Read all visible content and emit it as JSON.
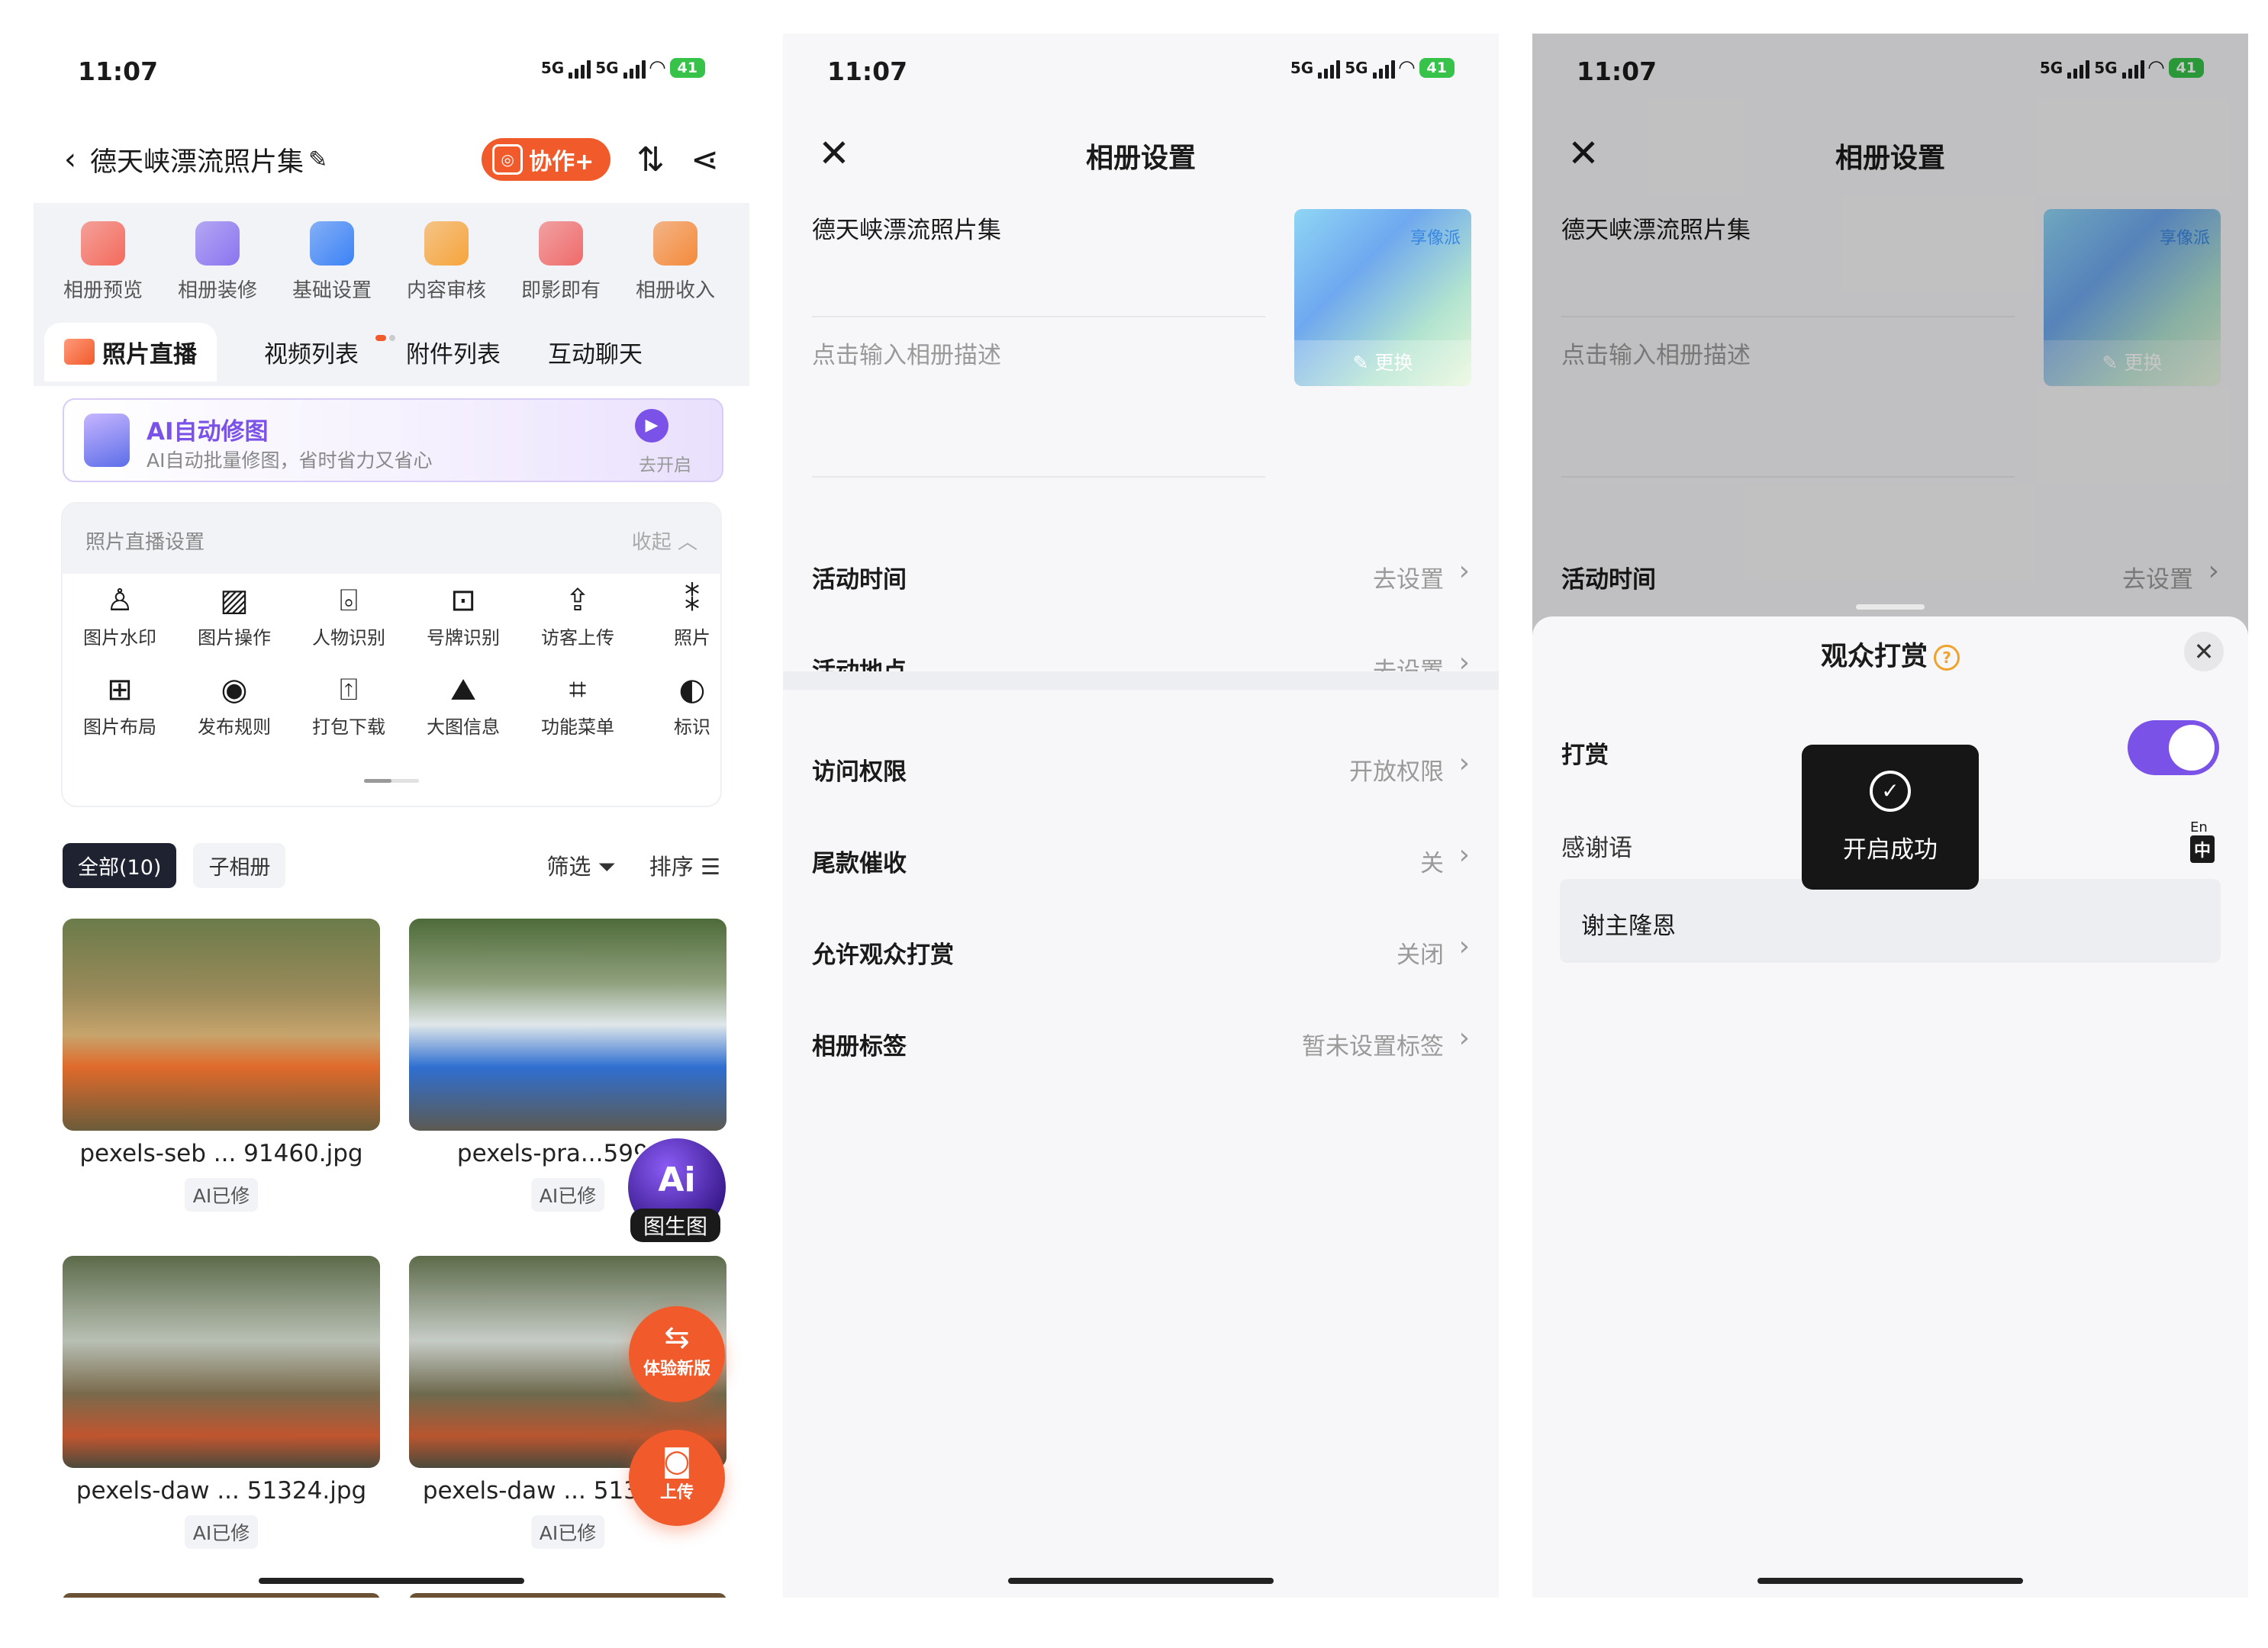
{
  "status_bar": {
    "time": "11:07",
    "net1": "5G",
    "net2": "5G",
    "battery": "41"
  },
  "screen1": {
    "header": {
      "back_icon": "chevron-left-icon",
      "title": "德天峡漂流照片集",
      "collab_label": "协作+",
      "sort_icon": "sort-icon",
      "share_icon": "share-icon"
    },
    "tools": [
      {
        "label": "相册预览",
        "color": "#f46a5c"
      },
      {
        "label": "相册装修",
        "color": "#8b74f0"
      },
      {
        "label": "基础设置",
        "color": "#3b82f6"
      },
      {
        "label": "内容审核",
        "color": "#f6a43b"
      },
      {
        "label": "即影即有",
        "color": "#f06a6a"
      },
      {
        "label": "相册收入",
        "color": "#f48a3b"
      }
    ],
    "tabs": [
      "照片直播",
      "视频列表",
      "附件列表",
      "互动聊天"
    ],
    "ai_banner": {
      "title": "AI自动修图",
      "subtitle": "AI自动批量修图，省时省力又省心",
      "action": "去开启"
    },
    "settings": {
      "title": "照片直播设置",
      "collapse": "收起",
      "items": [
        "图片水印",
        "图片操作",
        "人物识别",
        "号牌识别",
        "访客上传",
        "照片",
        "图片布局",
        "发布规则",
        "打包下载",
        "大图信息",
        "功能菜单",
        "标识"
      ],
      "icons": [
        "♙",
        "▨",
        "⌻",
        "⊡",
        "⇪",
        "⁑",
        "⊞",
        "◉",
        "⍐",
        "⛰",
        "⌗",
        "◐"
      ]
    },
    "filters": {
      "all": "全部(10)",
      "sub": "子相册",
      "filter": "筛选",
      "sort": "排序"
    },
    "photos": [
      {
        "name": "pexels-seb ... 91460.jpg",
        "tag": "AI已修"
      },
      {
        "name": "pexels-pra...59908",
        "tag": "AI已修"
      },
      {
        "name": "pexels-daw ... 51324.jpg",
        "tag": "AI已修"
      },
      {
        "name": "pexels-daw ... 51325.jpg",
        "tag": "AI已修"
      }
    ],
    "fab_ai": {
      "label": "图生图"
    },
    "fab_new": {
      "label": "体验新版"
    },
    "fab_upload": {
      "label": "上传"
    }
  },
  "screen2": {
    "title": "相册设置",
    "album_name": "德天峡漂流照片集",
    "desc_placeholder": "点击输入相册描述",
    "cover_brand": "享像派",
    "cover_change": "更换",
    "rows": [
      {
        "label": "活动时间",
        "value": "去设置"
      },
      {
        "label": "活动地点",
        "value": "去设置"
      },
      {
        "label": "访问权限",
        "value": "开放权限"
      },
      {
        "label": "尾款催收",
        "value": "关"
      },
      {
        "label": "允许观众打赏",
        "value": "关闭"
      },
      {
        "label": "相册标签",
        "value": "暂未设置标签"
      }
    ]
  },
  "screen3": {
    "title": "相册设置",
    "album_name": "德天峡漂流照片集",
    "desc_placeholder": "点击输入相册描述",
    "cover_brand": "享像派",
    "cover_change": "更换",
    "row": {
      "label": "活动时间",
      "value": "去设置"
    },
    "sheet": {
      "title": "观众打赏",
      "help": "?",
      "reward_label": "打赏",
      "reward_on": true,
      "thanks_label": "感谢语",
      "lang_en": "En",
      "lang_zh": "中",
      "thanks_value": "谢主隆恩"
    },
    "toast": "开启成功"
  },
  "colors": {
    "accent": "#f15a2b",
    "purple": "#7b52e8",
    "dark": "#1f2230"
  }
}
